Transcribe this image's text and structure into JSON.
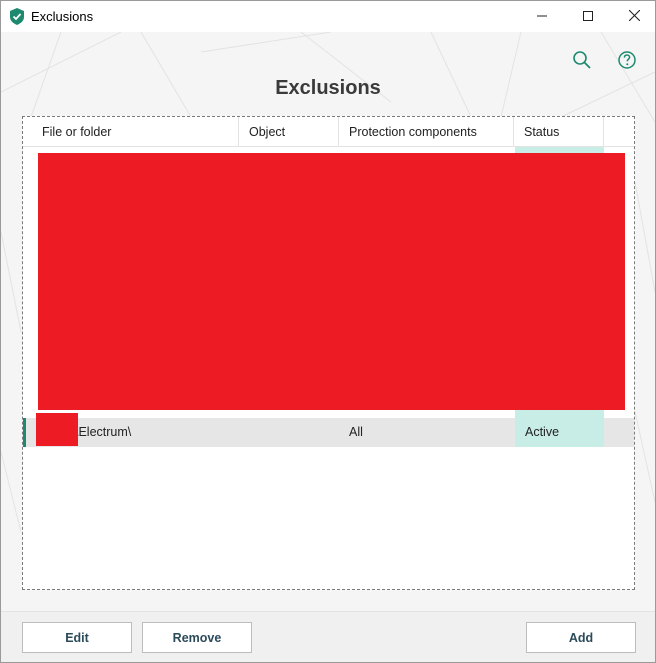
{
  "window": {
    "title": "Exclusions",
    "icon": "kaspersky-shield-icon",
    "controls": [
      "minimize-icon",
      "maximize-icon",
      "close-icon"
    ]
  },
  "header": {
    "title": "Exclusions",
    "icons": [
      "search-icon",
      "help-icon"
    ]
  },
  "table": {
    "columns": [
      "File or folder",
      "Object",
      "Protection components",
      "Status"
    ],
    "rows": [
      {
        "path": "\\Electrum\\",
        "object": "",
        "components": "All",
        "status": "Active"
      }
    ]
  },
  "footer": {
    "edit_label": "Edit",
    "remove_label": "Remove",
    "add_label": "Add"
  },
  "colors": {
    "accent": "#1d8a6f",
    "status_highlight": "#c8ece6",
    "redaction": "#ed1c24"
  }
}
